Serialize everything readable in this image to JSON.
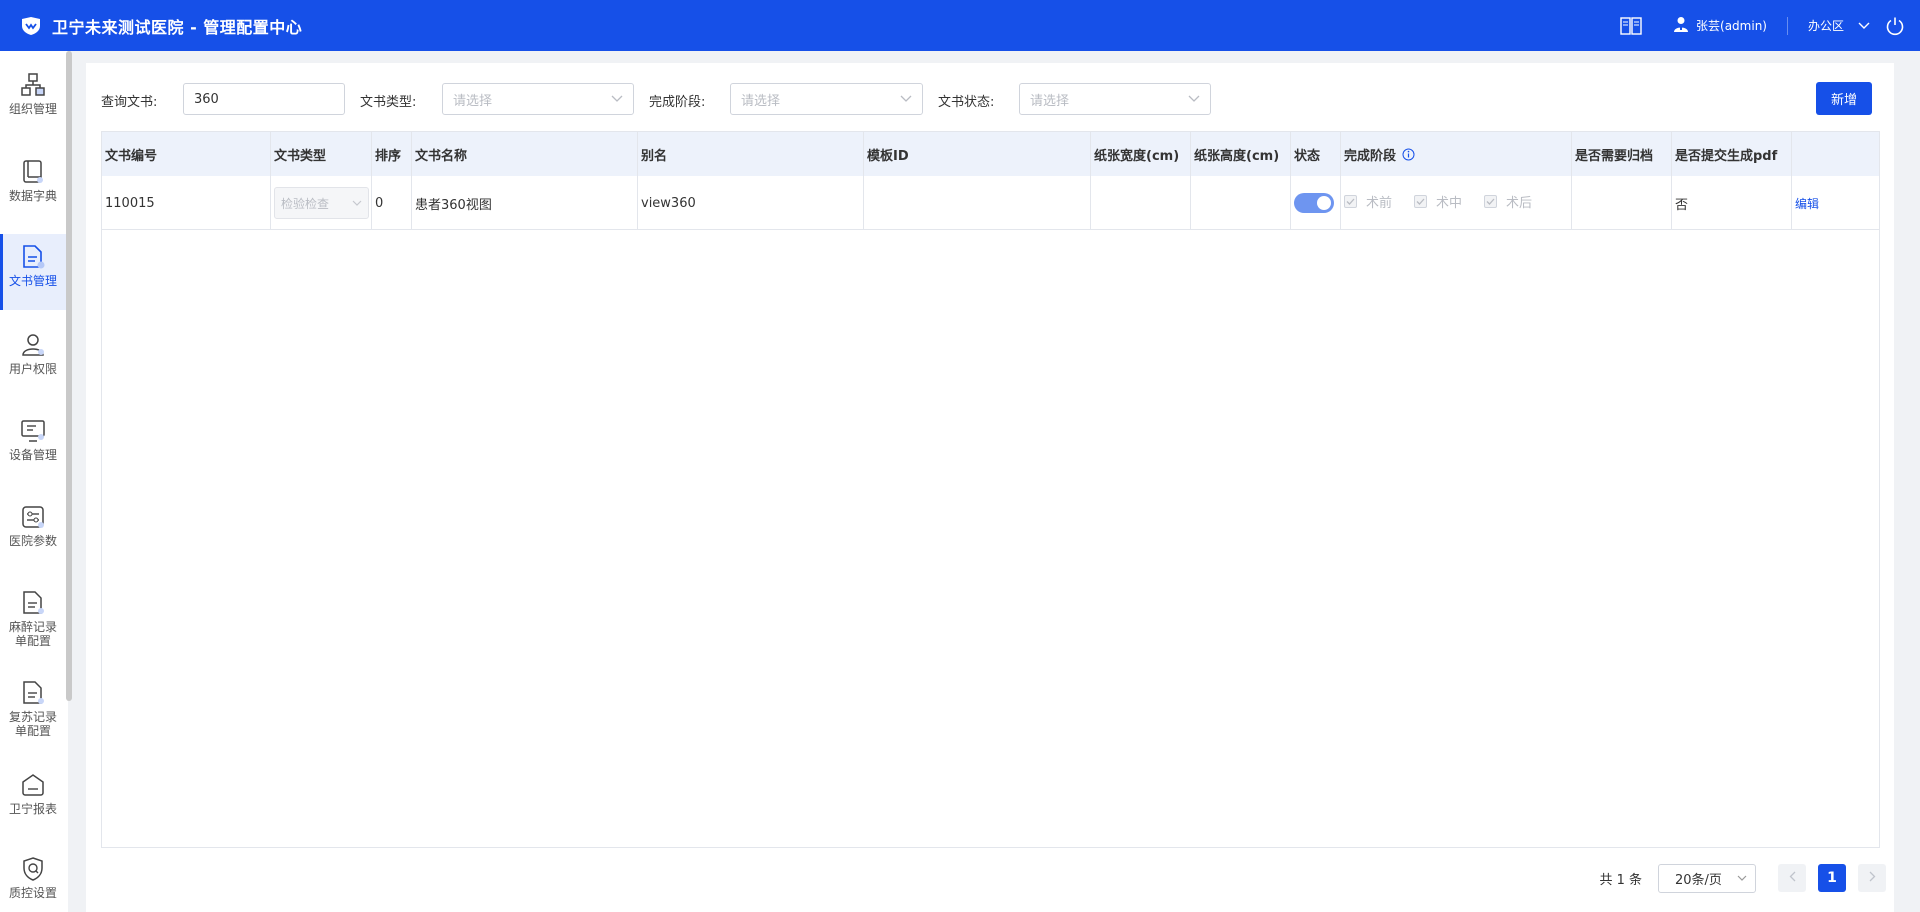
{
  "header": {
    "title": "卫宁未来测试医院 - 管理配置中心",
    "user": "张芸(admin)",
    "zone": "办公区",
    "icons": [
      "logo-icon",
      "book-icon",
      "user-icon",
      "chevron-down-icon",
      "power-icon"
    ]
  },
  "sidebar": {
    "items": [
      {
        "label": "组织管理",
        "icon": "org-chart-icon"
      },
      {
        "label": "数据字典",
        "icon": "dictionary-icon"
      },
      {
        "label": "文书管理",
        "icon": "document-icon",
        "active": true
      },
      {
        "label": "用户权限",
        "icon": "user-permission-icon"
      },
      {
        "label": "设备管理",
        "icon": "monitor-icon"
      },
      {
        "label": "医院参数",
        "icon": "settings-panel-icon"
      },
      {
        "label": "麻醉记录单配置",
        "icon": "anesthesia-record-icon"
      },
      {
        "label": "复苏记录单配置",
        "icon": "recovery-record-icon"
      },
      {
        "label": "卫宁报表",
        "icon": "report-icon"
      },
      {
        "label": "质控设置",
        "icon": "quality-control-icon"
      }
    ]
  },
  "filters": {
    "doc_label": "查询文书:",
    "doc_value": "360",
    "type_label": "文书类型:",
    "type_placeholder": "请选择",
    "stage_label": "完成阶段:",
    "stage_placeholder": "请选择",
    "status_label": "文书状态:",
    "status_placeholder": "请选择",
    "new_button": "新增"
  },
  "table": {
    "columns": [
      "文书编号",
      "文书类型",
      "排序",
      "文书名称",
      "别名",
      "模板ID",
      "纸张宽度(cm)",
      "纸张高度(cm)",
      "状态",
      "完成阶段",
      "是否需要归档",
      "是否提交生成pdf",
      ""
    ],
    "rows": [
      {
        "code": "110015",
        "type": "检验检查",
        "order": "0",
        "name": "患者360视图",
        "alias": "view360",
        "template_id": "",
        "width": "",
        "height": "",
        "status_on": true,
        "stages": [
          "术前",
          "术中",
          "术后"
        ],
        "archive": "",
        "pdf": "否",
        "action": "编辑"
      }
    ]
  },
  "pagination": {
    "total": "共 1 条",
    "page_size": "20条/页",
    "current_page": "1"
  },
  "colors": {
    "primary": "#1650e8",
    "header_bg": "#1650e8",
    "table_head_bg": "#edf2fb",
    "toggle_on": "#6e95f0"
  }
}
